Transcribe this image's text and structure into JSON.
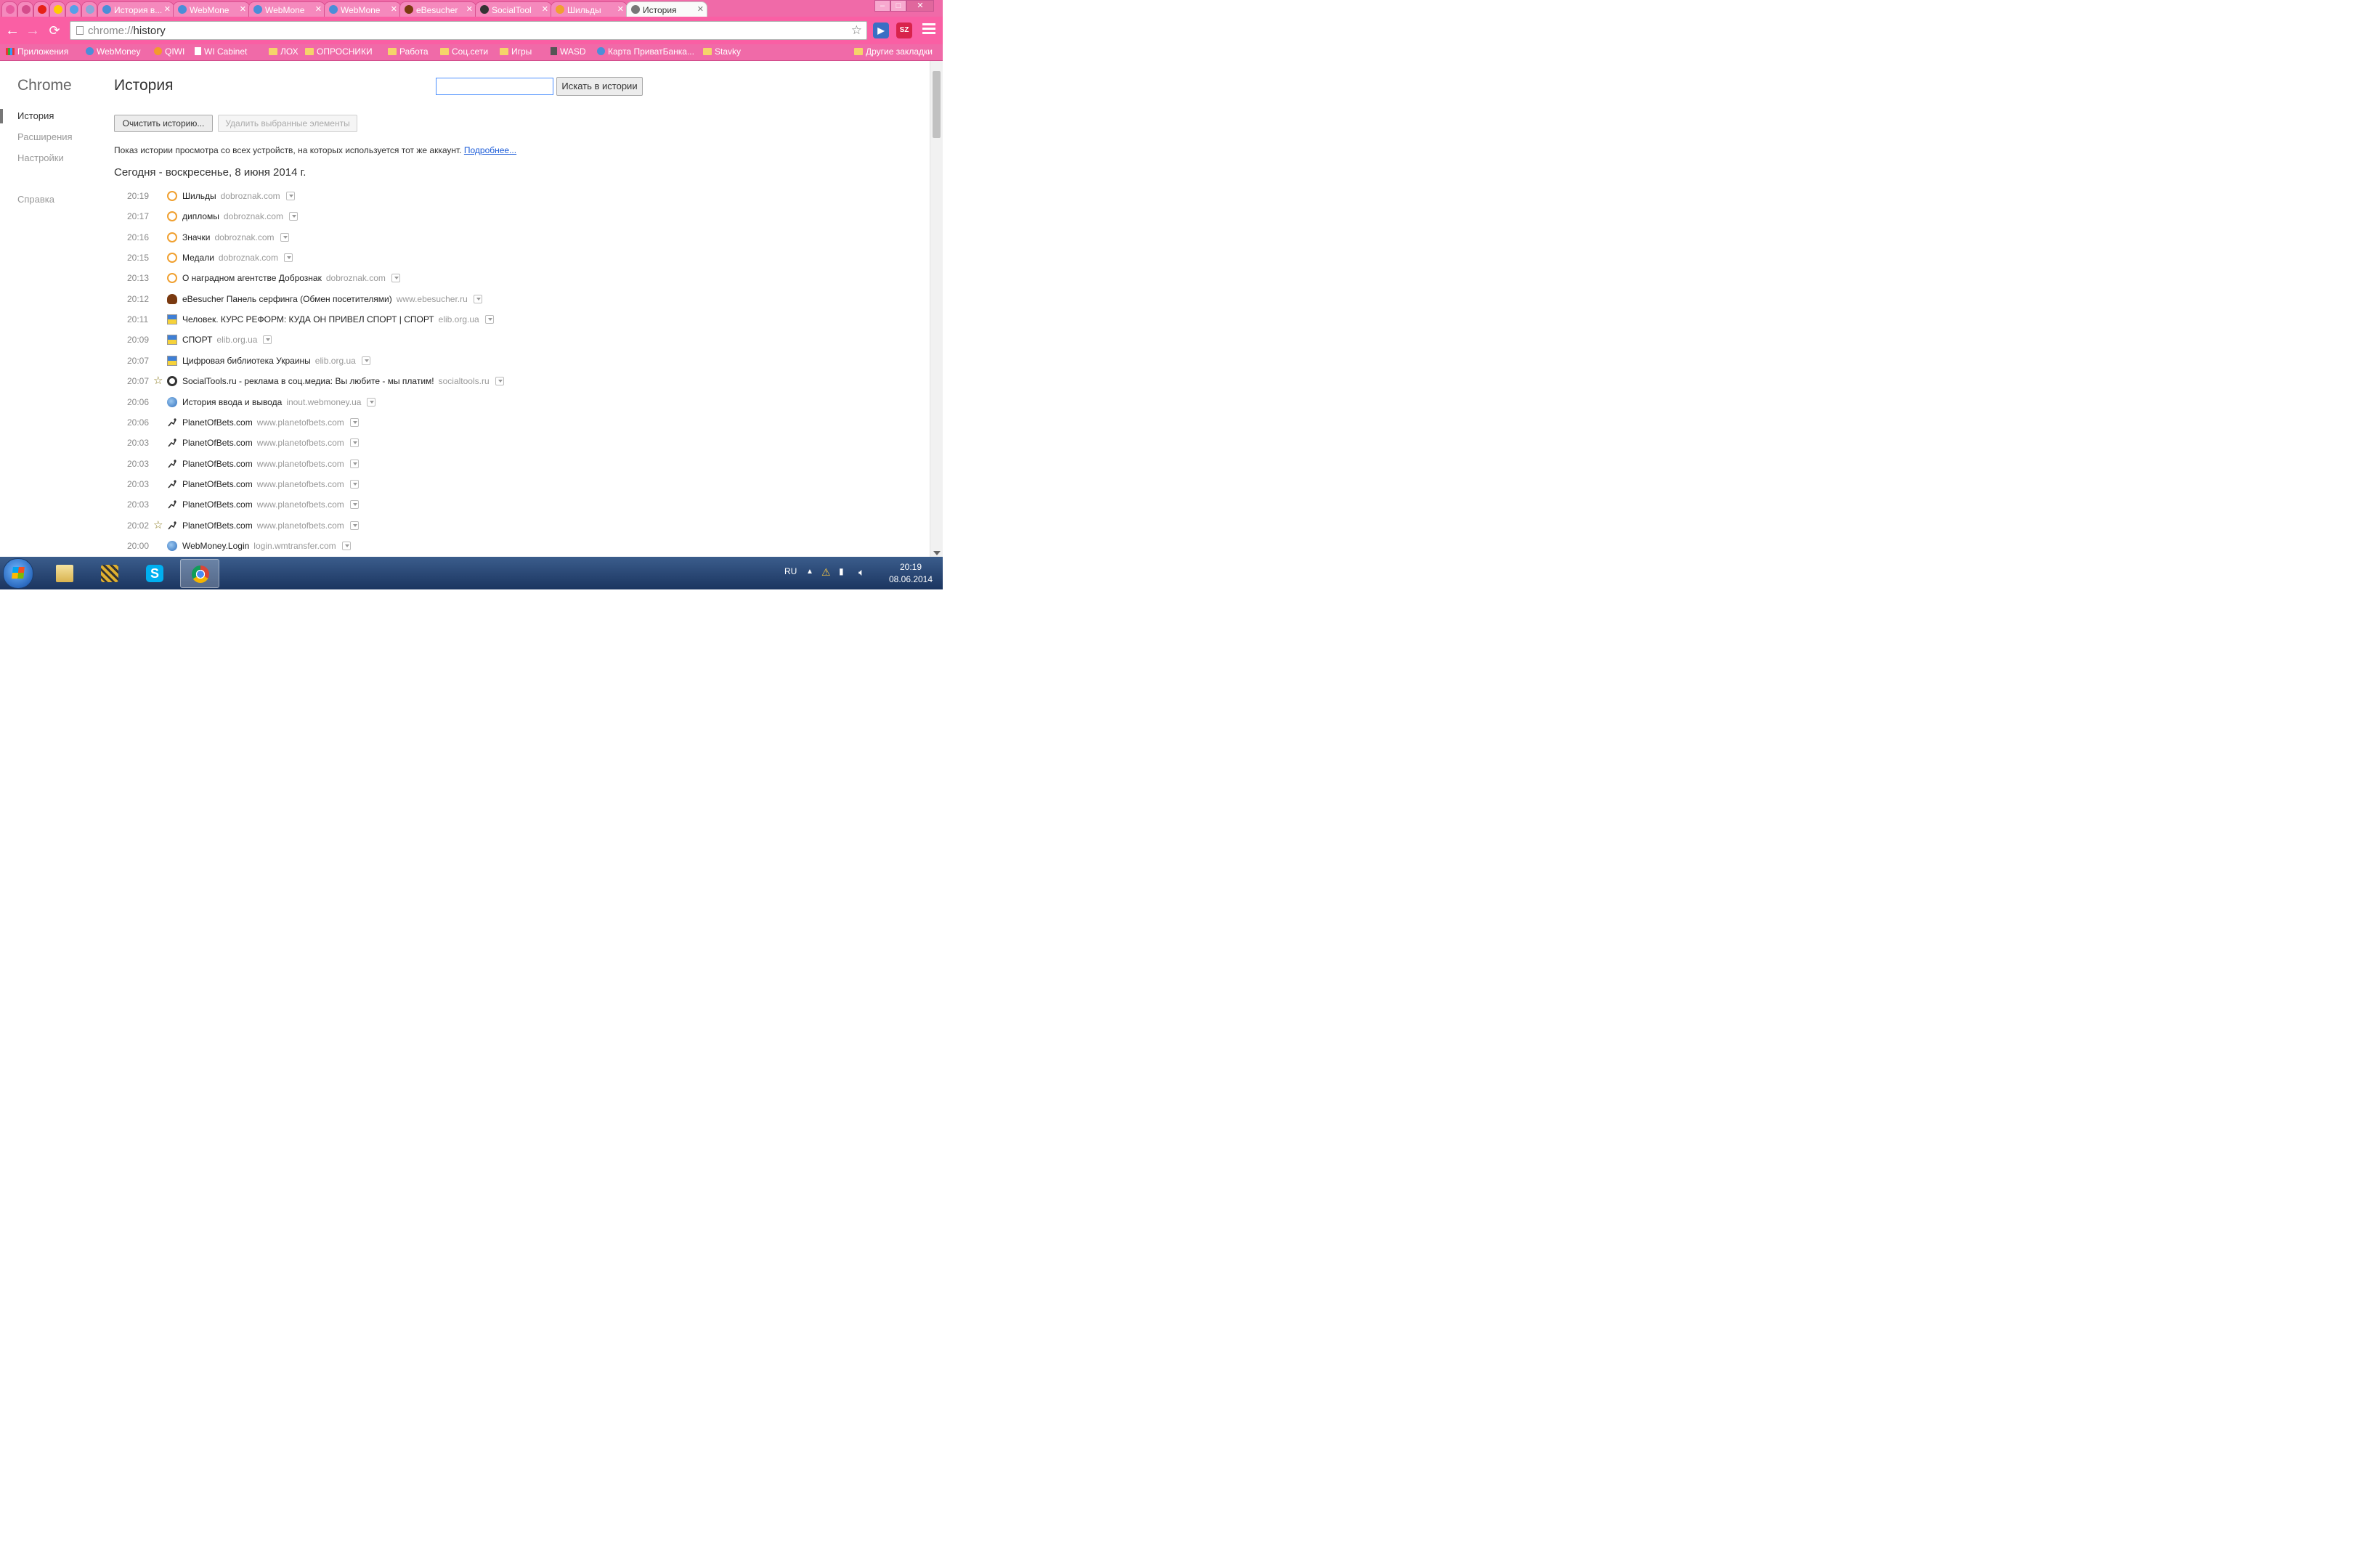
{
  "tabs": [
    {
      "title": "",
      "favicon": "pink-globe-icon",
      "color": "#e85a9f"
    },
    {
      "title": "",
      "favicon": "mail-icon",
      "color": "#d54c8c"
    },
    {
      "title": "",
      "favicon": "youtube-icon",
      "color": "#e62117"
    },
    {
      "title": "",
      "favicon": "yandex-icon",
      "color": "#ffcc00"
    },
    {
      "title": "",
      "favicon": "link-icon",
      "color": "#55a0e8"
    },
    {
      "title": "",
      "favicon": "globe-icon",
      "color": "#8aa8d8"
    },
    {
      "title": "История в...",
      "favicon": "webmoney-icon",
      "color": "#4a8ed8"
    },
    {
      "title": "WebMone",
      "favicon": "webmoney-icon",
      "color": "#4a8ed8"
    },
    {
      "title": "WebMone",
      "favicon": "webmoney-icon",
      "color": "#4a8ed8"
    },
    {
      "title": "WebMone",
      "favicon": "webmoney-icon",
      "color": "#4a8ed8"
    },
    {
      "title": "eBesucher",
      "favicon": "ebesucher-icon",
      "color": "#7a3a10"
    },
    {
      "title": "SocialTool",
      "favicon": "socialtools-icon",
      "color": "#333333"
    },
    {
      "title": "Шильды",
      "favicon": "dobroznak-icon",
      "color": "#f0a030"
    },
    {
      "title": "История",
      "favicon": "chrome-history-icon",
      "color": "#777777",
      "active": true
    }
  ],
  "address_bar": {
    "scheme": "chrome://",
    "path": "history"
  },
  "bookmarks": [
    {
      "label": "Приложения",
      "icon": "apps-icon"
    },
    {
      "label": "WebMoney",
      "icon": "globe-icon"
    },
    {
      "label": "QIWI",
      "icon": "qiwi-icon"
    },
    {
      "label": "WI Cabinet",
      "icon": "page-icon"
    },
    {
      "label": "ЛОХ",
      "icon": "folder-icon"
    },
    {
      "label": "ОПРОСНИКИ",
      "icon": "folder-icon"
    },
    {
      "label": "Работа",
      "icon": "folder-icon"
    },
    {
      "label": "Соц.сети",
      "icon": "folder-icon"
    },
    {
      "label": "Игры",
      "icon": "folder-icon"
    },
    {
      "label": "WASD",
      "icon": "wasd-icon"
    },
    {
      "label": "Карта ПриватБанка...",
      "icon": "globe-icon"
    },
    {
      "label": "Stavky",
      "icon": "folder-icon"
    },
    {
      "label": "Другие закладки",
      "icon": "folder-icon"
    }
  ],
  "sidebar": {
    "title": "Chrome",
    "items": [
      "История",
      "Расширения",
      "Настройки",
      "Справка"
    ]
  },
  "page": {
    "title": "История",
    "search_button": "Искать в истории",
    "clear_button": "Очистить историю...",
    "remove_button": "Удалить выбранные элементы",
    "info_text": "Показ истории просмотра со всех устройств, на которых используется тот же аккаунт.",
    "info_link": "Подробнее...",
    "day_header": "Сегодня - воскресенье, 8 июня 2014 г."
  },
  "history": [
    {
      "time": "20:19",
      "title": "Шильды",
      "domain": "dobroznak.com",
      "icon": "dobroznak-icon",
      "starred": false
    },
    {
      "time": "20:17",
      "title": "дипломы",
      "domain": "dobroznak.com",
      "icon": "dobroznak-icon",
      "starred": false
    },
    {
      "time": "20:16",
      "title": "Значки",
      "domain": "dobroznak.com",
      "icon": "dobroznak-icon",
      "starred": false
    },
    {
      "time": "20:15",
      "title": "Медали",
      "domain": "dobroznak.com",
      "icon": "dobroznak-icon",
      "starred": false
    },
    {
      "time": "20:13",
      "title": "О наградном агентстве Добрознак",
      "domain": "dobroznak.com",
      "icon": "dobroznak-icon",
      "starred": false
    },
    {
      "time": "20:12",
      "title": "eBesucher Панель серфинга (Обмен посетителями)",
      "domain": "www.ebesucher.ru",
      "icon": "ebesucher-icon",
      "starred": false
    },
    {
      "time": "20:11",
      "title": "Человек. КУРС РЕФОРМ: КУДА ОН ПРИВЕЛ СПОРТ | СПОРТ",
      "domain": "elib.org.ua",
      "icon": "elib-icon",
      "starred": false
    },
    {
      "time": "20:09",
      "title": "СПОРТ",
      "domain": "elib.org.ua",
      "icon": "elib-icon",
      "starred": false
    },
    {
      "time": "20:07",
      "title": "Цифровая библиотека Украины",
      "domain": "elib.org.ua",
      "icon": "elib-icon",
      "starred": false
    },
    {
      "time": "20:07",
      "title": "SocialTools.ru - реклама в соц.медиа: Вы любите - мы платим!",
      "domain": "socialtools.ru",
      "icon": "socialtools-icon",
      "starred": true
    },
    {
      "time": "20:06",
      "title": "История ввода и вывода",
      "domain": "inout.webmoney.ua",
      "icon": "webmoney-icon",
      "starred": false
    },
    {
      "time": "20:06",
      "title": "PlanetOfBets.com",
      "domain": "www.planetofbets.com",
      "icon": "planetofbets-icon",
      "starred": false
    },
    {
      "time": "20:03",
      "title": "PlanetOfBets.com",
      "domain": "www.planetofbets.com",
      "icon": "planetofbets-icon",
      "starred": false
    },
    {
      "time": "20:03",
      "title": "PlanetOfBets.com",
      "domain": "www.planetofbets.com",
      "icon": "planetofbets-icon",
      "starred": false
    },
    {
      "time": "20:03",
      "title": "PlanetOfBets.com",
      "domain": "www.planetofbets.com",
      "icon": "planetofbets-icon",
      "starred": false
    },
    {
      "time": "20:03",
      "title": "PlanetOfBets.com",
      "domain": "www.planetofbets.com",
      "icon": "planetofbets-icon",
      "starred": false
    },
    {
      "time": "20:02",
      "title": "PlanetOfBets.com",
      "domain": "www.planetofbets.com",
      "icon": "planetofbets-icon",
      "starred": true
    },
    {
      "time": "20:00",
      "title": "WebMoney.Login",
      "domain": "login.wmtransfer.com",
      "icon": "webmoney-icon",
      "starred": false
    }
  ],
  "taskbar": {
    "apps": [
      {
        "name": "explorer-icon",
        "color": "#e8c869"
      },
      {
        "name": "winamp-icon",
        "color": "#d8a020"
      },
      {
        "name": "skype-icon",
        "color": "#00aff0"
      },
      {
        "name": "chrome-icon",
        "color": "#db4437",
        "active": true
      }
    ],
    "language": "RU",
    "time": "20:19",
    "date": "08.06.2014"
  }
}
